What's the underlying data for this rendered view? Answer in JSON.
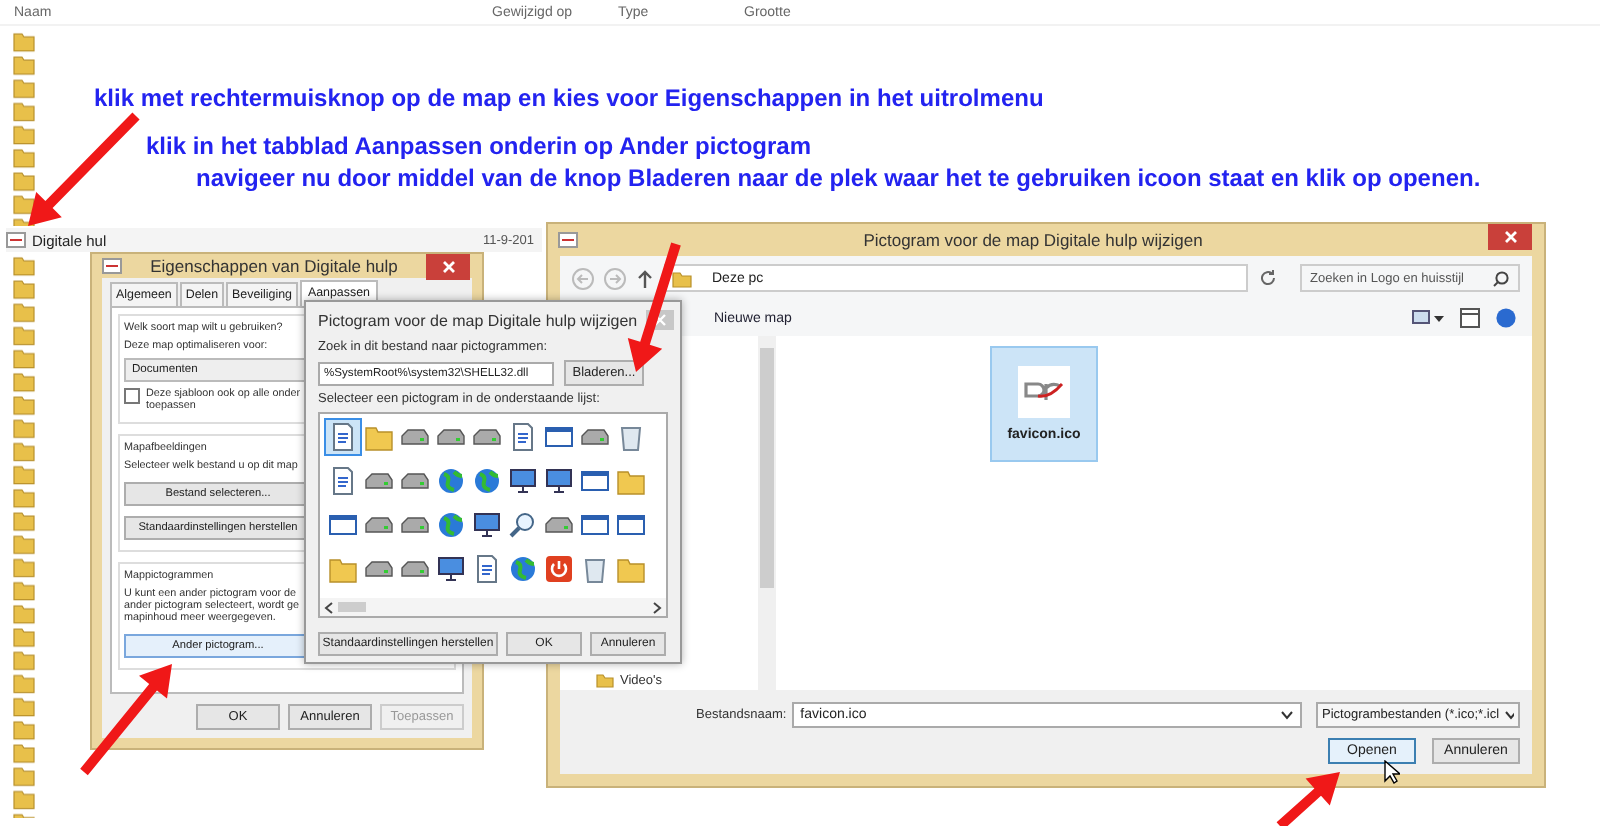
{
  "explorer": {
    "columns": [
      "Naam",
      "Gewijzigd op",
      "Type",
      "Grootte"
    ],
    "row": {
      "name": "Digitale hul",
      "modified": "11-9-201"
    }
  },
  "instructions": [
    "klik met rechtermuisknop op de map en kies voor Eigenschappen in het uitrolmenu",
    "klik in het tabblad Aanpassen onderin op Ander pictogram",
    "navigeer nu door middel van de knop Bladeren naar de plek waar het te gebruiken icoon staat en klik op openen."
  ],
  "properties_window": {
    "title": "Eigenschappen van Digitale hulp",
    "tabs": [
      {
        "label": "Algemeen",
        "selected": false
      },
      {
        "label": "Delen",
        "selected": false
      },
      {
        "label": "Beveiliging",
        "selected": false
      },
      {
        "label": "Aanpassen",
        "selected": true
      }
    ],
    "folder_type": {
      "heading": "Welk soort map wilt u gebruiken?",
      "label": "Deze map optimaliseren voor:",
      "value": "Documenten",
      "checkbox": {
        "label": "Deze sjabloon ook op alle onder",
        "label_2": "toepassen",
        "checked": false
      }
    },
    "pictures": {
      "heading": "Mapafbeeldingen",
      "text": "Selecteer welk bestand u op dit map",
      "buttons": [
        "Bestand selecteren...",
        "Standaardinstellingen herstellen"
      ]
    },
    "folder_icons": {
      "heading": "Mappictogrammen",
      "lines": [
        "U kunt een ander pictogram voor de",
        "ander pictogram selecteert, wordt ge",
        "mapinhoud meer weergegeven."
      ],
      "button": "Ander pictogram..."
    },
    "buttons": [
      {
        "label": "OK",
        "disabled": false
      },
      {
        "label": "Annuleren",
        "disabled": false
      },
      {
        "label": "Toepassen",
        "disabled": true
      }
    ]
  },
  "icon_dialog": {
    "title": "Pictogram voor de map Digitale hulp wijzigen",
    "search_label": "Zoek in dit bestand naar pictogrammen:",
    "path": "%SystemRoot%\\system32\\SHELL32.dll",
    "browse": "Bladeren...",
    "list_label": "Selecteer een pictogram in de onderstaande lijst:",
    "icons": [
      {
        "selected": true
      },
      {
        "selected": false
      },
      {
        "selected": false
      },
      {
        "selected": false
      },
      {
        "selected": false
      },
      {
        "selected": false
      },
      {
        "selected": false
      },
      {
        "selected": false
      },
      {
        "selected": false
      },
      {
        "selected": false
      },
      {
        "selected": false
      },
      {
        "selected": false
      },
      {
        "selected": false
      },
      {
        "selected": false
      },
      {
        "selected": false
      },
      {
        "selected": false
      },
      {
        "selected": false
      },
      {
        "selected": false
      },
      {
        "selected": false
      },
      {
        "selected": false
      },
      {
        "selected": false
      },
      {
        "selected": false
      },
      {
        "selected": false
      },
      {
        "selected": false
      },
      {
        "selected": false
      },
      {
        "selected": false
      },
      {
        "selected": false
      },
      {
        "selected": false
      },
      {
        "selected": false
      },
      {
        "selected": false
      },
      {
        "selected": false
      },
      {
        "selected": false
      },
      {
        "selected": false
      },
      {
        "selected": false
      },
      {
        "selected": false
      },
      {
        "selected": false
      }
    ],
    "buttons": [
      "Standaardinstellingen herstellen",
      "OK",
      "Annuleren"
    ]
  },
  "file_dialog": {
    "title": "Pictogram voor de map Digitale hulp wijzigen",
    "breadcrumb": "Deze pc",
    "search_placeholder": "Zoeken in Logo en huisstijl",
    "new_folder": "Nieuwe map",
    "sidebar_item": "Video's",
    "file": {
      "name": "favicon.ico",
      "selected": true
    },
    "filename_label": "Bestandsnaam:",
    "filename": "favicon.ico",
    "filter": "Pictogrambestanden (*.ico;*.icl",
    "buttons": [
      "Openen",
      "Annuleren"
    ]
  }
}
